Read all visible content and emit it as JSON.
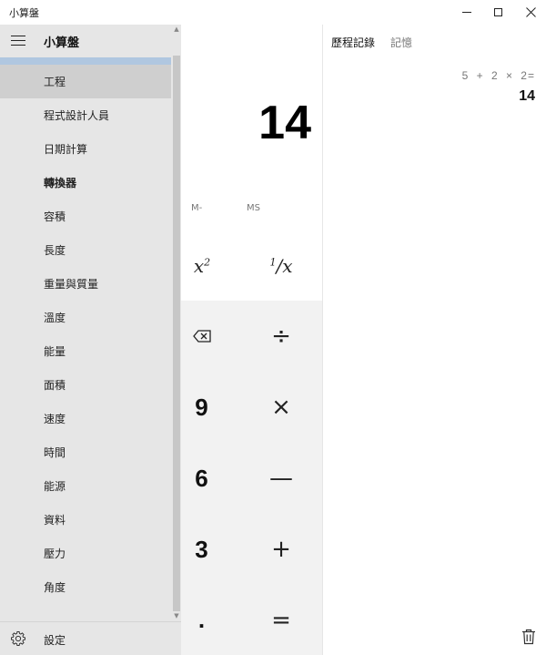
{
  "window": {
    "title": "小算盤"
  },
  "nav": {
    "title": "小算盤",
    "items": [
      {
        "label": "工程",
        "selected": true,
        "heading": false
      },
      {
        "label": "程式設計人員",
        "selected": false,
        "heading": false
      },
      {
        "label": "日期計算",
        "selected": false,
        "heading": false
      },
      {
        "label": "轉換器",
        "selected": false,
        "heading": true
      },
      {
        "label": "容積",
        "selected": false,
        "heading": false
      },
      {
        "label": "長度",
        "selected": false,
        "heading": false
      },
      {
        "label": "重量與質量",
        "selected": false,
        "heading": false
      },
      {
        "label": "溫度",
        "selected": false,
        "heading": false
      },
      {
        "label": "能量",
        "selected": false,
        "heading": false
      },
      {
        "label": "面積",
        "selected": false,
        "heading": false
      },
      {
        "label": "速度",
        "selected": false,
        "heading": false
      },
      {
        "label": "時間",
        "selected": false,
        "heading": false
      },
      {
        "label": "能源",
        "selected": false,
        "heading": false
      },
      {
        "label": "資料",
        "selected": false,
        "heading": false
      },
      {
        "label": "壓力",
        "selected": false,
        "heading": false
      },
      {
        "label": "角度",
        "selected": false,
        "heading": false
      }
    ],
    "settings_label": "設定"
  },
  "calculator": {
    "display": "14",
    "memory": {
      "m_minus": "M-",
      "ms": "MS"
    },
    "keys": {
      "nine": "9",
      "six": "6",
      "three": "3",
      "decimal": ".",
      "divide": "÷",
      "multiply": "×",
      "subtract": "—",
      "add": "+",
      "equals": "="
    }
  },
  "history": {
    "tab_history": "歷程記錄",
    "tab_memory": "記憶",
    "entries": [
      {
        "expression": "5 + 2 × 2=",
        "result": "14"
      }
    ]
  },
  "colors": {
    "accent": "#b0c7e0",
    "nav_bg": "#e6e6e6",
    "selected_item": "#cfcfcf",
    "keypad_bg": "#f2f2f2"
  }
}
